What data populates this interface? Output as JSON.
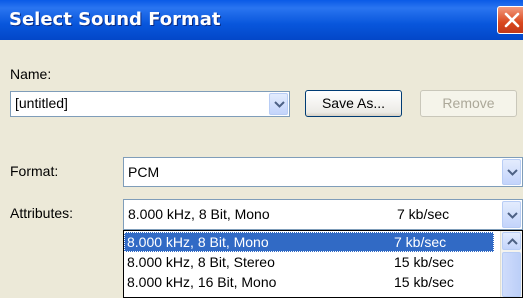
{
  "window": {
    "title": "Select Sound Format"
  },
  "name_section": {
    "label": "Name:",
    "value": "[untitled]",
    "save_as_label": "Save As...",
    "remove_label": "Remove"
  },
  "format": {
    "label": "Format:",
    "value": "PCM"
  },
  "attributes": {
    "label": "Attributes:",
    "value": "8.000 kHz, 8 Bit, Mono",
    "rate": "7 kb/sec",
    "options": [
      {
        "value": "8.000 kHz, 8 Bit, Mono",
        "rate": "7 kb/sec"
      },
      {
        "value": "8.000 kHz, 8 Bit, Stereo",
        "rate": "15 kb/sec"
      },
      {
        "value": "8.000 kHz, 16 Bit, Mono",
        "rate": "15 kb/sec"
      }
    ]
  },
  "colors": {
    "titlebar": "#0a5ae6",
    "selection": "#316ac5",
    "dialog_bg": "#ece9d8"
  }
}
